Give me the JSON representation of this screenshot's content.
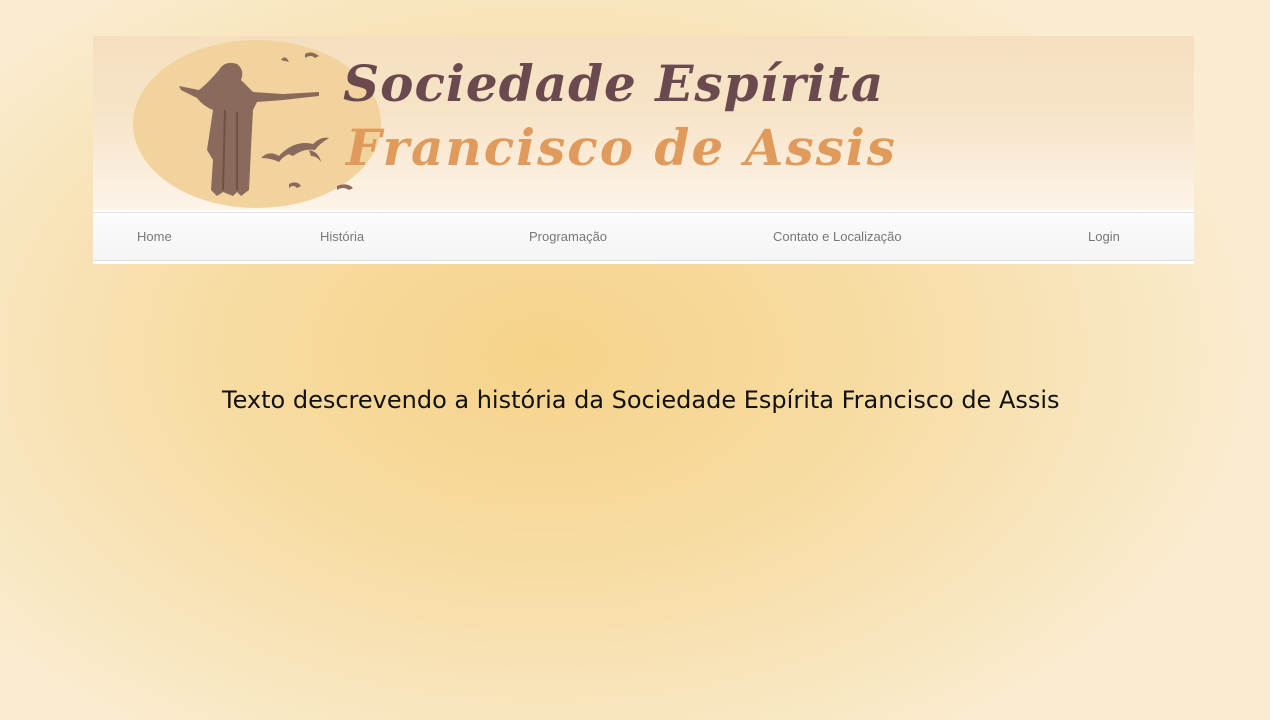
{
  "header": {
    "logo_line1": "Sociedade Espírita",
    "logo_line2": "Francisco de Assis"
  },
  "nav": {
    "items": [
      {
        "label": "Home"
      },
      {
        "label": "História"
      },
      {
        "label": "Programação"
      },
      {
        "label": "Contato e Localização"
      },
      {
        "label": "Login"
      }
    ]
  },
  "main": {
    "text": "Texto descrevendo a história da Sociedade Espírita Francisco de Assis"
  },
  "colors": {
    "logo_primary": "#6b4a4f",
    "logo_secondary": "#df9a5c",
    "logo_circle": "#f2d39d",
    "figure": "#8a6a5c",
    "nav_text": "#777777"
  },
  "icons": {
    "logo_mark": "saint-francis-with-birds"
  }
}
